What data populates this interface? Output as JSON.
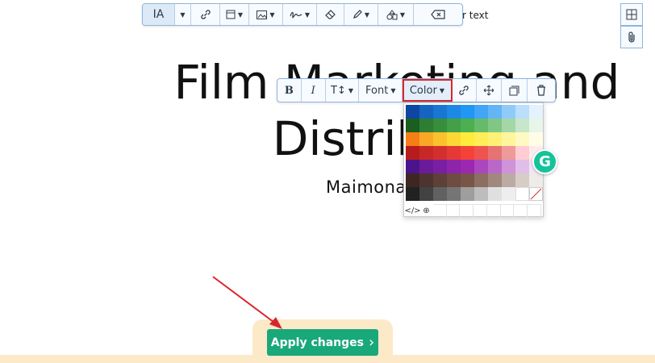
{
  "document": {
    "title_line1": "Film Marketing and",
    "title_line2": "Distrib",
    "subtitle": "Maimona",
    "hint_text": "r text"
  },
  "top_toolbar": {
    "buttons": [
      {
        "icon": "text-style-icon",
        "label": "IA"
      },
      {
        "icon": "chevron-down-icon"
      },
      {
        "icon": "link-icon"
      },
      {
        "icon": "layout-icon"
      },
      {
        "icon": "image-icon"
      },
      {
        "icon": "signature-icon"
      },
      {
        "icon": "eraser-icon"
      },
      {
        "icon": "highlighter-icon"
      },
      {
        "icon": "shapes-icon"
      },
      {
        "icon": "backspace-icon"
      }
    ]
  },
  "format_toolbar": {
    "bold": "B",
    "italic": "I",
    "size": "T↕",
    "font": "Font",
    "color": "Color"
  },
  "color_palette": {
    "rows": [
      [
        "#0d47a1",
        "#1565c0",
        "#1976d2",
        "#1e88e5",
        "#2196f3",
        "#42a5f5",
        "#64b5f6",
        "#90caf9",
        "#bbdefb",
        "#e3f2fd"
      ],
      [
        "#1b5e20",
        "#2e7d32",
        "#388e3c",
        "#43a047",
        "#4caf50",
        "#66bb6a",
        "#81c784",
        "#a5d6a7",
        "#c8e6c9",
        "#e8f5e9"
      ],
      [
        "#f57f17",
        "#f9a825",
        "#fbc02d",
        "#fdd835",
        "#ffeb3b",
        "#ffee58",
        "#fff176",
        "#fff59d",
        "#fff9c4",
        "#fffde7"
      ],
      [
        "#b71c1c",
        "#c62828",
        "#d32f2f",
        "#e53935",
        "#f44336",
        "#ef5350",
        "#e57373",
        "#ef9a9a",
        "#ffcdd2",
        "#ffebee"
      ],
      [
        "#4a148c",
        "#6a1b9a",
        "#7b1fa2",
        "#8e24aa",
        "#9c27b0",
        "#ab47bc",
        "#ba68c8",
        "#ce93d8",
        "#e1bee7",
        "#f3e5f5"
      ],
      [
        "#3e2723",
        "#4e342e",
        "#5d4037",
        "#6d4c41",
        "#795548",
        "#8d6e63",
        "#a1887f",
        "#bcaaa4",
        "#d7ccc8",
        "#efebe9"
      ],
      [
        "#212121",
        "#424242",
        "#616161",
        "#757575",
        "#9e9e9e",
        "#bdbdbd",
        "#e0e0e0",
        "#eeeeee",
        "#ffffff",
        "none"
      ]
    ],
    "code_icon": "</>",
    "picker_icon": "⊕"
  },
  "grammarly": {
    "label": "G"
  },
  "apply_button": {
    "label": "Apply changes",
    "chevron": "›"
  },
  "colors": {
    "accent_green": "#19a87a",
    "toolbar_border": "#8fb6dd",
    "highlight_red": "#d9262c",
    "footer_bg": "#fbe9c8"
  }
}
